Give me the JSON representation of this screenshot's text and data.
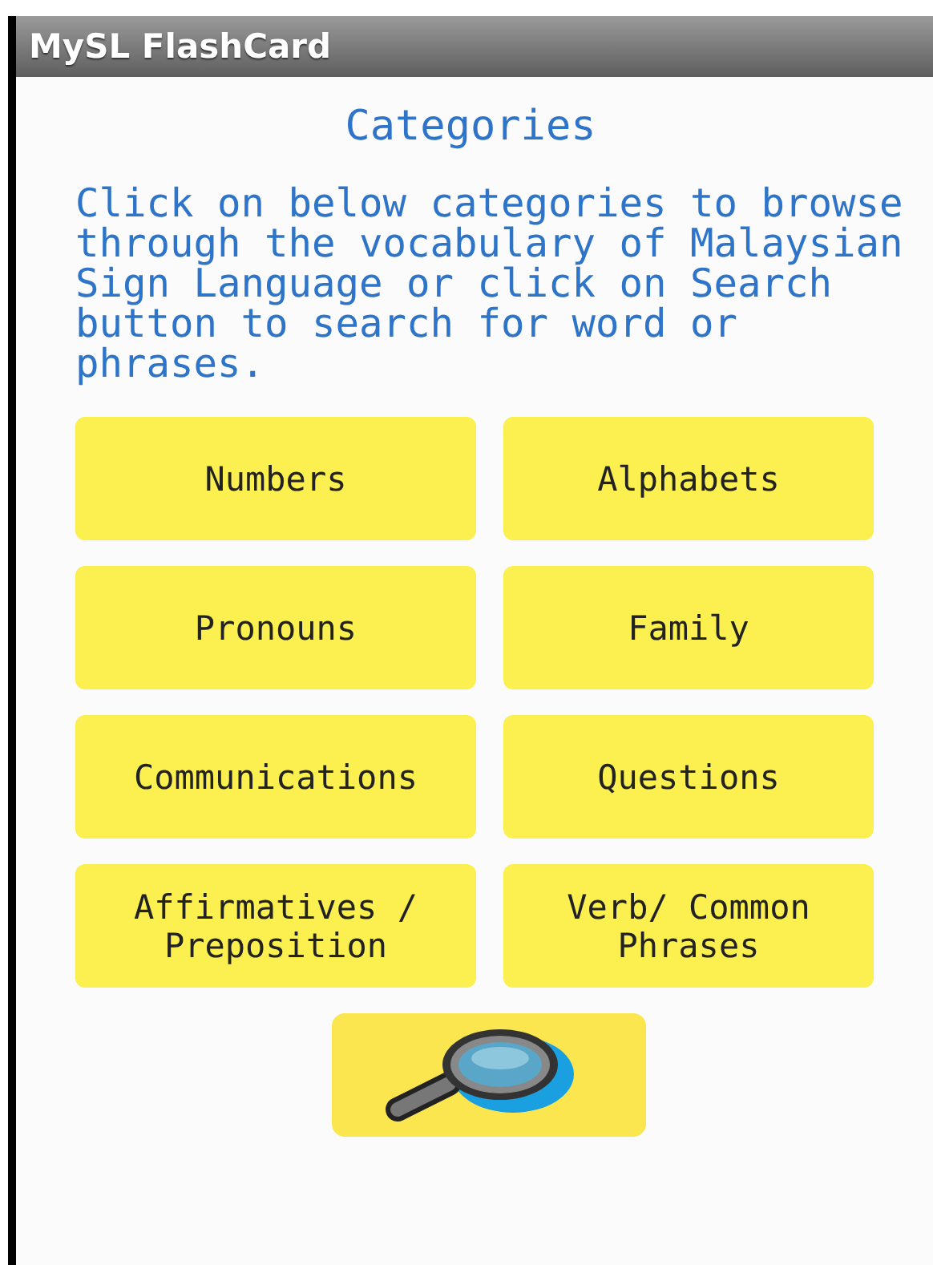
{
  "window": {
    "title": "MySL FlashCard"
  },
  "heading": "Categories",
  "instructions": "Click on below categories to browse through the vocabulary of Malaysian Sign Language or click on Search button to search for word or phrases.",
  "categories": [
    {
      "label": "Numbers"
    },
    {
      "label": "Alphabets"
    },
    {
      "label": "Pronouns"
    },
    {
      "label": "Family"
    },
    {
      "label": "Communications"
    },
    {
      "label": "Questions"
    },
    {
      "label": "Affirmatives /\nPreposition"
    },
    {
      "label": "Verb/ Common\nPhrases"
    }
  ]
}
